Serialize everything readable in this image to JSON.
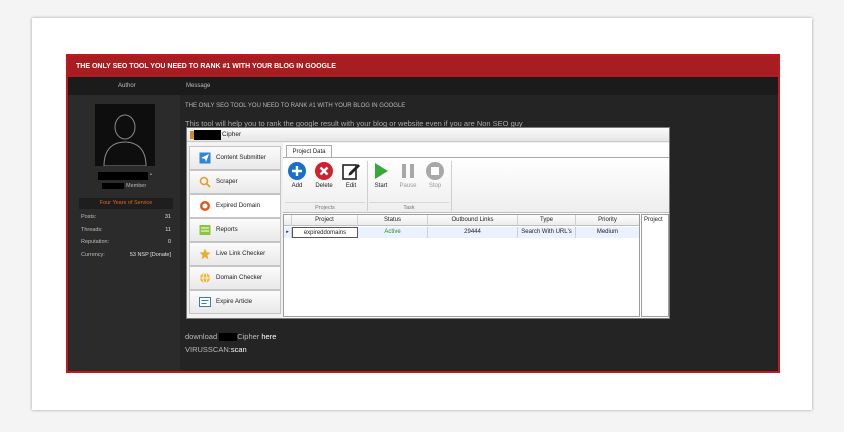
{
  "forum": {
    "thread_title": "THE ONLY SEO TOOL YOU NEED TO RANK #1 WITH YOUR BLOG IN GOOGLE",
    "col_author": "Author",
    "col_message": "Message",
    "user_title": "Member",
    "service_badge": "Four Years of Service",
    "stats": [
      {
        "label": "Posts:",
        "value": "31"
      },
      {
        "label": "Threads:",
        "value": "11"
      },
      {
        "label": "Reputation:",
        "value": "0"
      },
      {
        "label": "Currency:",
        "value": "53 NSP [Donate]"
      }
    ],
    "post_title": "THE ONLY SEO TOOL YOU NEED TO RANK #1 WITH YOUR BLOG IN GOOGLE",
    "post_desc": "This tool will help you to rank the google result with your blog or website even if you are Non SEO guy",
    "download_prefix": "download",
    "download_suffix": "Cipher",
    "download_link": "here",
    "virus_prefix": "VIRUSSCAN:",
    "virus_link": "scan"
  },
  "app": {
    "title": "Cipher",
    "nav": [
      {
        "label": "Content Submitter",
        "icon": "send-icon"
      },
      {
        "label": "Scraper",
        "icon": "magnifier-icon"
      },
      {
        "label": "Expired Domain",
        "icon": "ring-icon"
      },
      {
        "label": "Reports",
        "icon": "report-icon"
      },
      {
        "label": "Live Link Checker",
        "icon": "star-icon"
      },
      {
        "label": "Domain Checker",
        "icon": "globe-icon"
      },
      {
        "label": "Expire Article",
        "icon": "article-icon"
      }
    ],
    "tab": "Project Data",
    "ribbon": {
      "add": "Add",
      "delete": "Delete",
      "edit": "Edit",
      "start": "Start",
      "pause": "Pause",
      "stop": "Stop",
      "group_projects": "Projects",
      "group_task": "Task"
    },
    "grid": {
      "headers": [
        "Project",
        "Status",
        "Outbound Links",
        "Type",
        "Priority"
      ],
      "row": [
        "expireddomains",
        "Active",
        "29444",
        "Search With URL's",
        "Medium"
      ],
      "side_header": "Project"
    }
  }
}
